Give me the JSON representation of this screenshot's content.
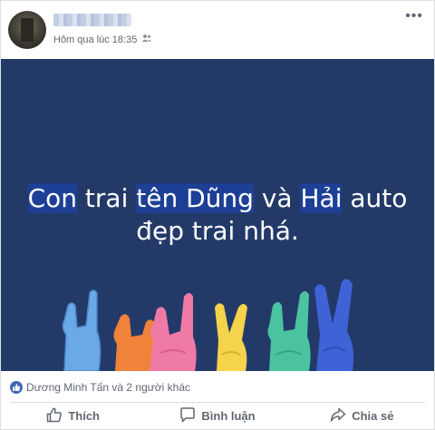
{
  "post": {
    "timestamp": "Hôm qua lúc 18:35",
    "audience_icon": "friends-icon",
    "more_icon": "more-options-icon",
    "banner": {
      "line1_parts": [
        "Con",
        " trai ",
        "tên Dũng",
        " và ",
        "Hải",
        " auto"
      ],
      "line2": "đẹp trai nhá.",
      "background": "#233a69"
    },
    "reactions": {
      "icon": "like-reaction-icon",
      "text": "Dương Minh Tấn và 2 người khác"
    },
    "actions": {
      "like": "Thích",
      "comment": "Bình luận",
      "share": "Chia sẻ"
    }
  }
}
